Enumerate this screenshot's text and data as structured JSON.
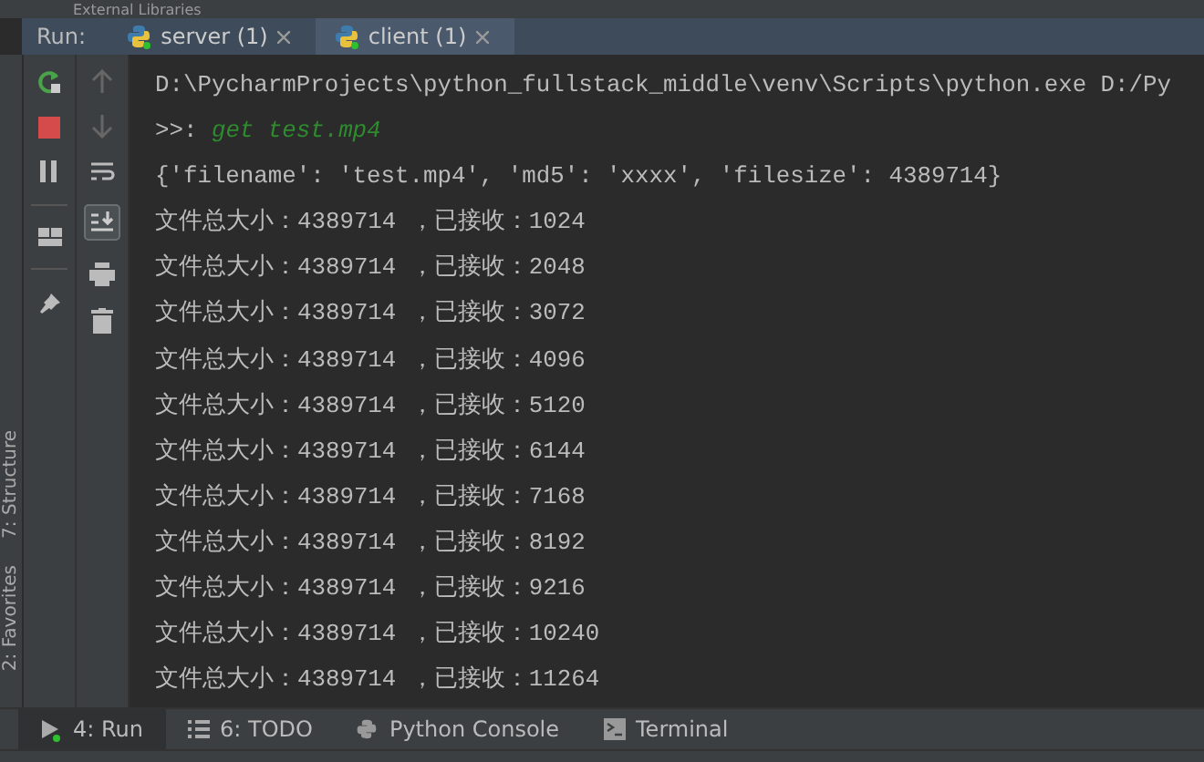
{
  "project_tree_item": "External Libraries",
  "run_bar": {
    "label": "Run:",
    "tabs": [
      {
        "label": "server (1)",
        "selected": false
      },
      {
        "label": "client (1)",
        "selected": true
      }
    ]
  },
  "side_tabs": [
    {
      "label": "7: Structure"
    },
    {
      "label": "2: Favorites"
    }
  ],
  "console": {
    "command_line": "D:\\PycharmProjects\\python_fullstack_middle\\venv\\Scripts\\python.exe D:/Py",
    "prompt": ">>: ",
    "input": "get test.mp4",
    "lines": [
      "{'filename': 'test.mp4', 'md5': 'xxxx', 'filesize': 4389714}",
      "文件总大小：4389714 ，已接收：1024",
      "文件总大小：4389714 ，已接收：2048",
      "文件总大小：4389714 ，已接收：3072",
      "文件总大小：4389714 ，已接收：4096",
      "文件总大小：4389714 ，已接收：5120",
      "文件总大小：4389714 ，已接收：6144",
      "文件总大小：4389714 ，已接收：7168",
      "文件总大小：4389714 ，已接收：8192",
      "文件总大小：4389714 ，已接收：9216",
      "文件总大小：4389714 ，已接收：10240",
      "文件总大小：4389714 ，已接收：11264"
    ]
  },
  "bottom_tabs": [
    {
      "kind": "run",
      "label": "4: Run",
      "selected": true
    },
    {
      "kind": "todo",
      "label": "6: TODO",
      "selected": false
    },
    {
      "kind": "python",
      "label": "Python Console",
      "selected": false
    },
    {
      "kind": "terminal",
      "label": "Terminal",
      "selected": false
    }
  ]
}
